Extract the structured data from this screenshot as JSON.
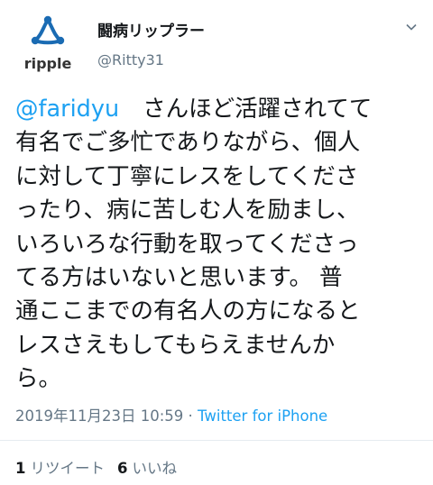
{
  "user": {
    "display_name": "闘病リップラー",
    "handle": "@Ritty31",
    "avatar": {
      "icon": "ripple-logo",
      "logo_text": "ripple",
      "color": "#1a6bb3"
    }
  },
  "menu": {
    "icon": "chevron-down-icon"
  },
  "tweet": {
    "mention": "@faridyu",
    "lines": [
      "さんほど活躍されてて",
      "有名でご多忙でありながら、個人",
      "に対して丁寧にレスをしてくださ",
      "ったり、病に苦しむ人を励まし、",
      "いろいろな行動を取ってくださっ",
      "てる方はいないと思います。 普",
      "通ここまでの有名人の方になると",
      "レスさえもしてもらえませんか",
      "ら。"
    ]
  },
  "meta": {
    "timestamp": "2019年11月23日 10:59",
    "separator": " · ",
    "source": "Twitter for iPhone"
  },
  "stats": {
    "retweets_count": "1",
    "retweets_label": "リツイート",
    "likes_count": "6",
    "likes_label": "いいね"
  },
  "colors": {
    "link": "#1da1f2",
    "secondary_text": "#657786",
    "primary_text": "#14171a",
    "divider": "#e6ecf0"
  }
}
